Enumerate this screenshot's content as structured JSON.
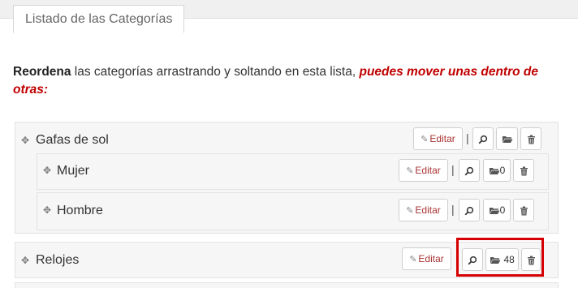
{
  "tab_title": "Listado de las Categorías",
  "intro": {
    "bold": "Reordena",
    "text": " las categorías arrastrando y soltando en esta lista, ",
    "highlight": "puedes mover unas dentro de otras:"
  },
  "edit_label": "Editar",
  "separator": "|",
  "categories": [
    {
      "name": "Gafas de sol",
      "count": ""
    },
    {
      "name": "Mujer",
      "count": "0"
    },
    {
      "name": "Hombre",
      "count": "0"
    },
    {
      "name": "Relojes",
      "count": "48"
    }
  ],
  "icons": {
    "drag": "move-icon",
    "edit": "pencil-icon",
    "view": "search-icon",
    "products": "folder-open-icon",
    "delete": "trash-icon"
  },
  "colors": {
    "highlight_text": "#c00000",
    "edit_text": "#a33333",
    "annotation_box": "#d60000"
  }
}
